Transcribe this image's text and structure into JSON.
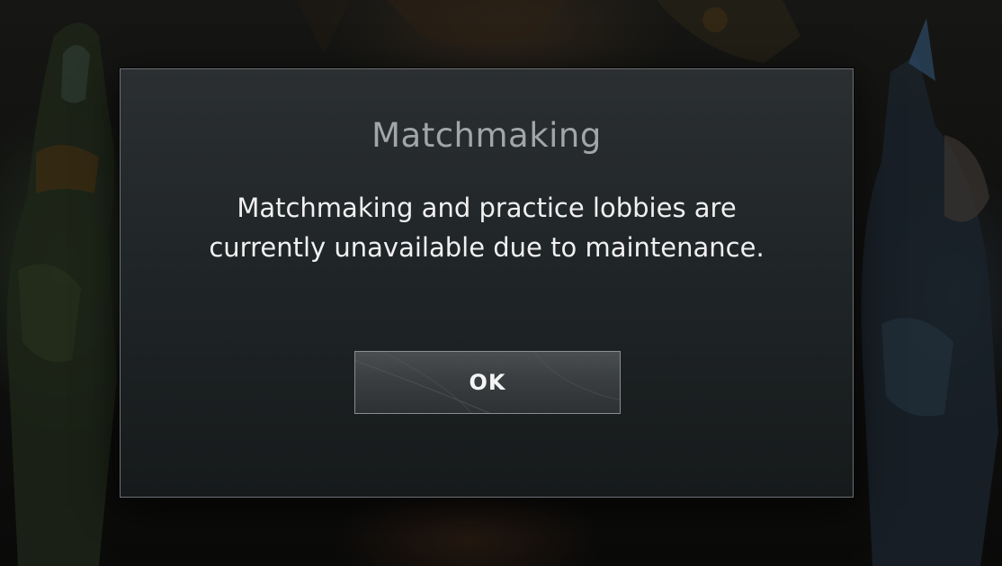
{
  "dialog": {
    "title": "Matchmaking",
    "message": "Matchmaking and practice lobbies are currently unavailable due to maintenance.",
    "ok_label": "OK"
  },
  "colors": {
    "dialog_border": "#6e7275",
    "title_text": "#a3a6a7",
    "message_text": "#f0f0f0",
    "button_border": "#8a8d8f"
  }
}
